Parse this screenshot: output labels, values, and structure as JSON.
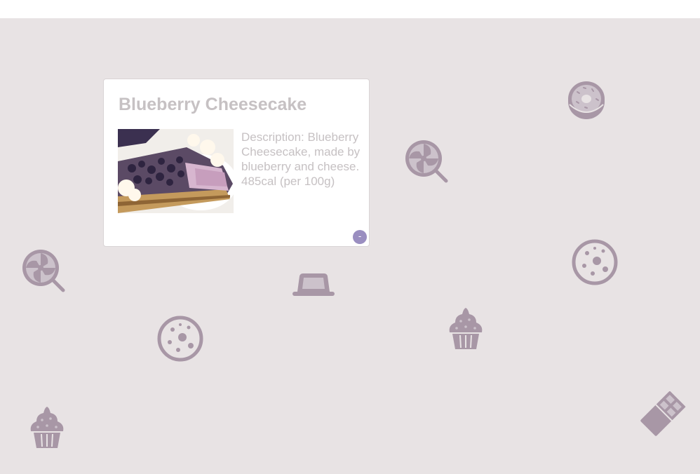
{
  "card": {
    "title": "Blueberry Cheesecake",
    "description": "Description: Blueberry Cheesecake, made by blueberry and cheese. 485cal (per 100g)",
    "collapse_label": "-"
  },
  "theme": {
    "background": "#e8e3e4",
    "icon_color": "#a897a6",
    "button_color": "#9a8ec0",
    "text_color": "#c6c1c3"
  },
  "candy_icons": [
    "donut-icon",
    "lollipop-icon",
    "cookie-icon",
    "butter-dish-icon",
    "cupcake-icon",
    "chocolate-bar-icon"
  ]
}
